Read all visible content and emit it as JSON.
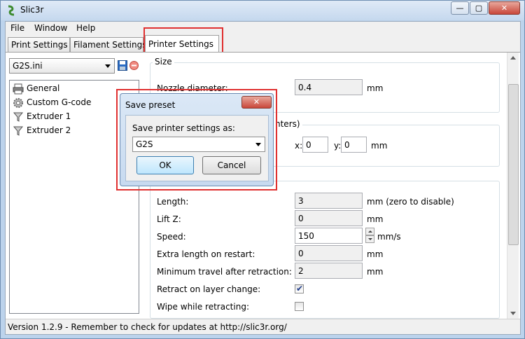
{
  "window": {
    "title": "Slic3r",
    "controls": {
      "minimize": "—",
      "maximize": "▢",
      "close": "✕"
    }
  },
  "menu": [
    "File",
    "Window",
    "Help"
  ],
  "tabs": [
    "Print Settings",
    "Filament Settings",
    "Printer Settings"
  ],
  "active_tab": "Printer Settings",
  "preset": {
    "selected": "G2S.ini"
  },
  "sidebar": {
    "items": [
      {
        "label": "General",
        "icon": "printer-icon",
        "selected": true
      },
      {
        "label": "Custom G-code",
        "icon": "gear-icon"
      },
      {
        "label": "Extruder 1",
        "icon": "funnel-icon"
      },
      {
        "label": "Extruder 2",
        "icon": "funnel-icon"
      }
    ]
  },
  "size_group": {
    "title": "Size",
    "nozzle_label": "Nozzle diameter:",
    "nozzle_value": "0.4",
    "nozzle_unit": "mm"
  },
  "position_group": {
    "title_fragment": "nters)",
    "x_label": "x:",
    "x_value": "0",
    "y_label": "y:",
    "y_value": "0",
    "unit": "mm"
  },
  "retraction": {
    "rows": [
      {
        "label": "Length:",
        "value": "3",
        "unit": "mm (zero to disable)"
      },
      {
        "label": "Lift Z:",
        "value": "0",
        "unit": "mm"
      },
      {
        "label": "Speed:",
        "value": "150",
        "unit": "mm/s"
      },
      {
        "label": "Extra length on restart:",
        "value": "0",
        "unit": "mm"
      },
      {
        "label": "Minimum travel after retraction:",
        "value": "2",
        "unit": "mm"
      }
    ],
    "checks": [
      {
        "label": "Retract on layer change:",
        "checked": true
      },
      {
        "label": "Wipe while retracting:",
        "checked": false
      }
    ]
  },
  "status": "Version 1.2.9 - Remember to check for updates at http://slic3r.org/",
  "dialog": {
    "title": "Save preset",
    "close": "✕",
    "prompt": "Save printer settings as:",
    "value": "G2S",
    "ok": "OK",
    "cancel": "Cancel"
  },
  "colors": {
    "highlight": "#e03030",
    "title_bar": "#c5d8ee",
    "accent": "#3c7fb1"
  }
}
